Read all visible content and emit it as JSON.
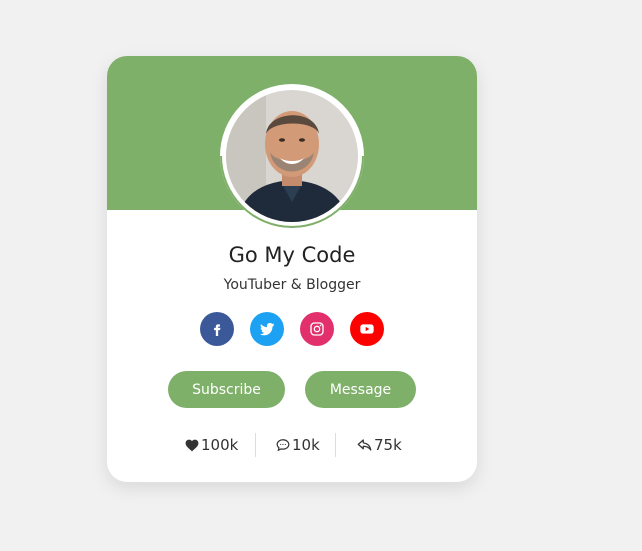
{
  "colors": {
    "accent": "#7fb069",
    "background": "#f1f1f1",
    "card": "#ffffff"
  },
  "profile": {
    "name": "Go My Code",
    "role": "YouTuber & Blogger",
    "avatar_icon": "user-portrait-photo"
  },
  "social": [
    {
      "name": "facebook",
      "icon": "facebook-icon",
      "color": "#3b5998"
    },
    {
      "name": "twitter",
      "icon": "twitter-icon",
      "color": "#1da1f2"
    },
    {
      "name": "instagram",
      "icon": "instagram-icon",
      "color": "#e1306c"
    },
    {
      "name": "youtube",
      "icon": "youtube-icon",
      "color": "#ff0000"
    }
  ],
  "buttons": {
    "subscribe_label": "Subscribe",
    "message_label": "Message"
  },
  "stats": {
    "likes": "100k",
    "comments": "10k",
    "shares": "75k"
  }
}
